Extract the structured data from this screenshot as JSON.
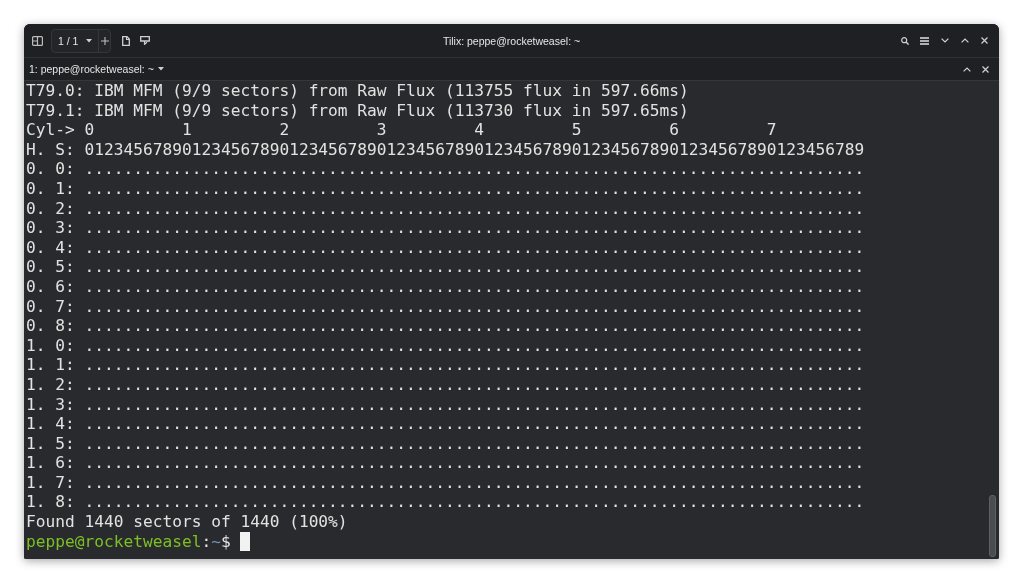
{
  "window": {
    "title": "Tilix: peppe@rocketweasel: ~",
    "session_switcher": "1 / 1"
  },
  "tab": {
    "title": "1: peppe@rocketweasel: ~"
  },
  "terminal": {
    "lines": [
      "T79.0: IBM MFM (9/9 sectors) from Raw Flux (113755 flux in 597.66ms)",
      "T79.1: IBM MFM (9/9 sectors) from Raw Flux (113730 flux in 597.65ms)",
      "Cyl-> 0         1         2         3         4         5         6         7",
      "H. S: 01234567890123456789012345678901234567890123456789012345678901234567890123456789",
      "0. 0: ................................................................................",
      "0. 1: ................................................................................",
      "0. 2: ................................................................................",
      "0. 3: ................................................................................",
      "0. 4: ................................................................................",
      "0. 5: ................................................................................",
      "0. 6: ................................................................................",
      "0. 7: ................................................................................",
      "0. 8: ................................................................................",
      "1. 0: ................................................................................",
      "1. 1: ................................................................................",
      "1. 2: ................................................................................",
      "1. 3: ................................................................................",
      "1. 4: ................................................................................",
      "1. 5: ................................................................................",
      "1. 6: ................................................................................",
      "1. 7: ................................................................................",
      "1. 8: ................................................................................",
      "Found 1440 sectors of 1440 (100%)"
    ],
    "prompt": {
      "user_host": "peppe@rocketweasel",
      "separator": ":",
      "path": "~",
      "symbol": "$"
    }
  }
}
